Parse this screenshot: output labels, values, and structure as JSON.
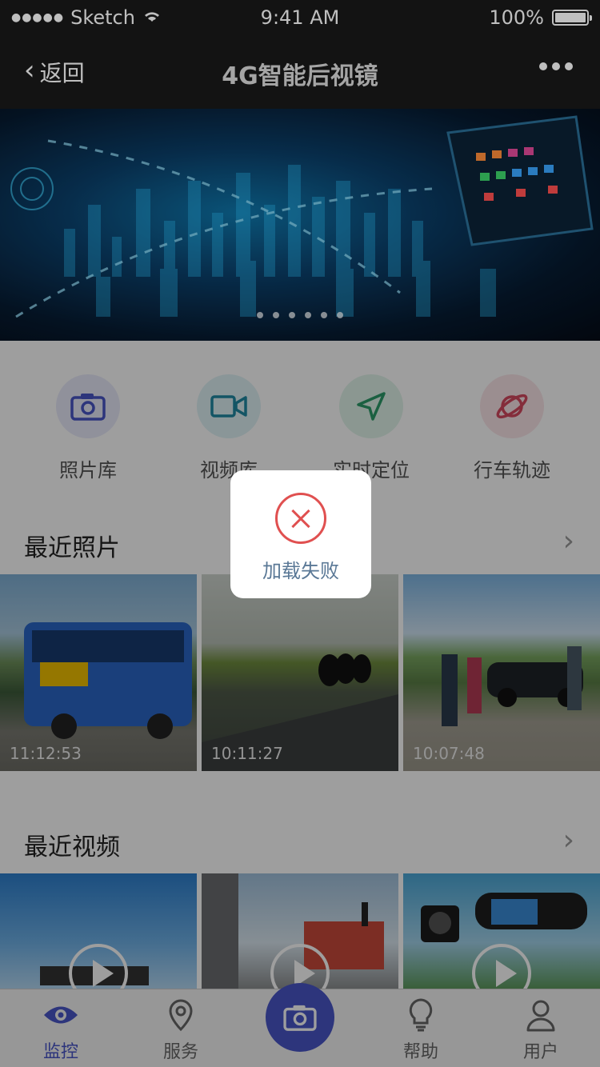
{
  "status_bar": {
    "carrier": "Sketch",
    "time": "9:41 AM",
    "battery": "100%"
  },
  "nav": {
    "back_label": "返回",
    "title": "4G智能后视镜"
  },
  "banner": {
    "page_count": 6
  },
  "quick_actions": [
    {
      "label": "照片库",
      "icon": "camera-icon",
      "color": "#4a56c8"
    },
    {
      "label": "视频库",
      "icon": "video-icon",
      "color": "#1f8aa3"
    },
    {
      "label": "实时定位",
      "icon": "navigation-icon",
      "color": "#2d9c6a"
    },
    {
      "label": "行车轨迹",
      "icon": "planet-icon",
      "color": "#d6495f"
    }
  ],
  "recent_photos": {
    "title": "最近照片",
    "items": [
      {
        "time": "11:12:53",
        "icon": "bus-photo"
      },
      {
        "time": "10:11:27",
        "icon": "motorcycle-photo"
      },
      {
        "time": "10:07:48",
        "icon": "roadside-photo"
      }
    ]
  },
  "recent_videos": {
    "title": "最近视频",
    "items": [
      {
        "icon": "highway-video"
      },
      {
        "icon": "city-traffic-video"
      },
      {
        "icon": "dashcam-video"
      }
    ]
  },
  "tabbar": {
    "items": [
      {
        "label": "监控",
        "icon": "eye-icon",
        "active": true
      },
      {
        "label": "服务",
        "icon": "location-pin-icon",
        "active": false
      },
      {
        "label": "",
        "icon": "camera-icon",
        "active": false
      },
      {
        "label": "帮助",
        "icon": "lightbulb-icon",
        "active": false
      },
      {
        "label": "用户",
        "icon": "user-icon",
        "active": false
      }
    ]
  },
  "toast": {
    "message": "加载失败",
    "icon": "error-x-icon"
  },
  "colors": {
    "accent": "#4a56c8",
    "error": "#e05050",
    "dark_bar": "#1a1a1a"
  }
}
